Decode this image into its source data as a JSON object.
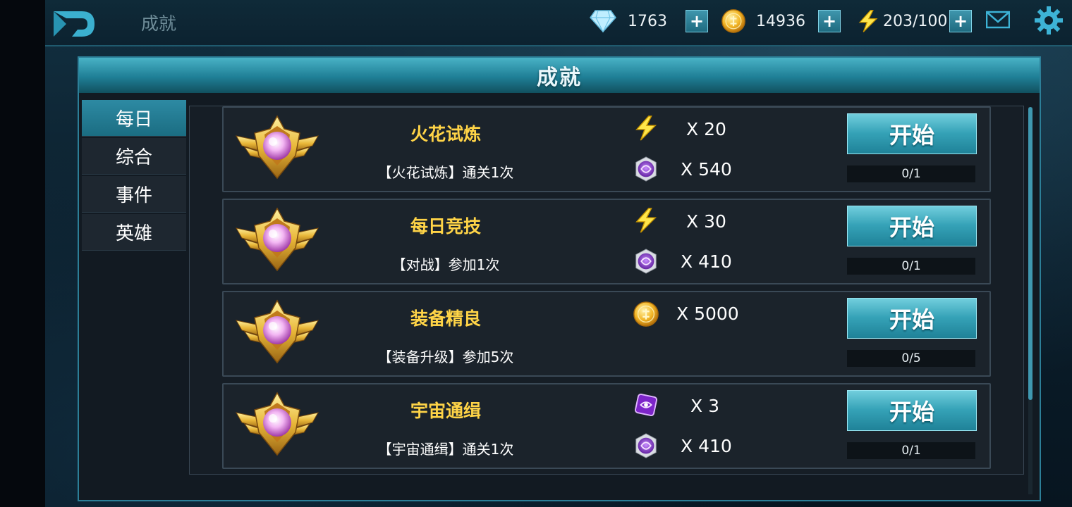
{
  "header": {
    "title": "成就"
  },
  "resources": {
    "diamonds": "1763",
    "coins": "14936",
    "energy": "203/100"
  },
  "panel": {
    "title": "成就"
  },
  "tabs": [
    {
      "label": "每日",
      "active": true
    },
    {
      "label": "综合",
      "active": false
    },
    {
      "label": "事件",
      "active": false
    },
    {
      "label": "英雄",
      "active": false
    }
  ],
  "quests": [
    {
      "name": "火花试炼",
      "description": "【火花试炼】通关1次",
      "rewards": [
        {
          "icon": "lightning-icon",
          "amount": "X 20"
        },
        {
          "icon": "purple-token-icon",
          "amount": "X 540"
        }
      ],
      "button": "开始",
      "progress": "0/1"
    },
    {
      "name": "每日竞技",
      "description": "【对战】参加1次",
      "rewards": [
        {
          "icon": "lightning-icon",
          "amount": "X 30"
        },
        {
          "icon": "purple-token-icon",
          "amount": "X 410"
        }
      ],
      "button": "开始",
      "progress": "0/1"
    },
    {
      "name": "装备精良",
      "description": "【装备升级】参加5次",
      "rewards": [
        {
          "icon": "gold-coin-icon",
          "amount": "X 5000"
        }
      ],
      "button": "开始",
      "progress": "0/5"
    },
    {
      "name": "宇宙通缉",
      "description": "【宇宙通缉】通关1次",
      "rewards": [
        {
          "icon": "purple-ticket-icon",
          "amount": "X 3"
        },
        {
          "icon": "purple-token-icon",
          "amount": "X 410"
        }
      ],
      "button": "开始",
      "progress": "0/1"
    }
  ],
  "colors": {
    "accent": "#2d8aa3",
    "quest_name": "#ffd447",
    "button": "#35a2b7"
  }
}
